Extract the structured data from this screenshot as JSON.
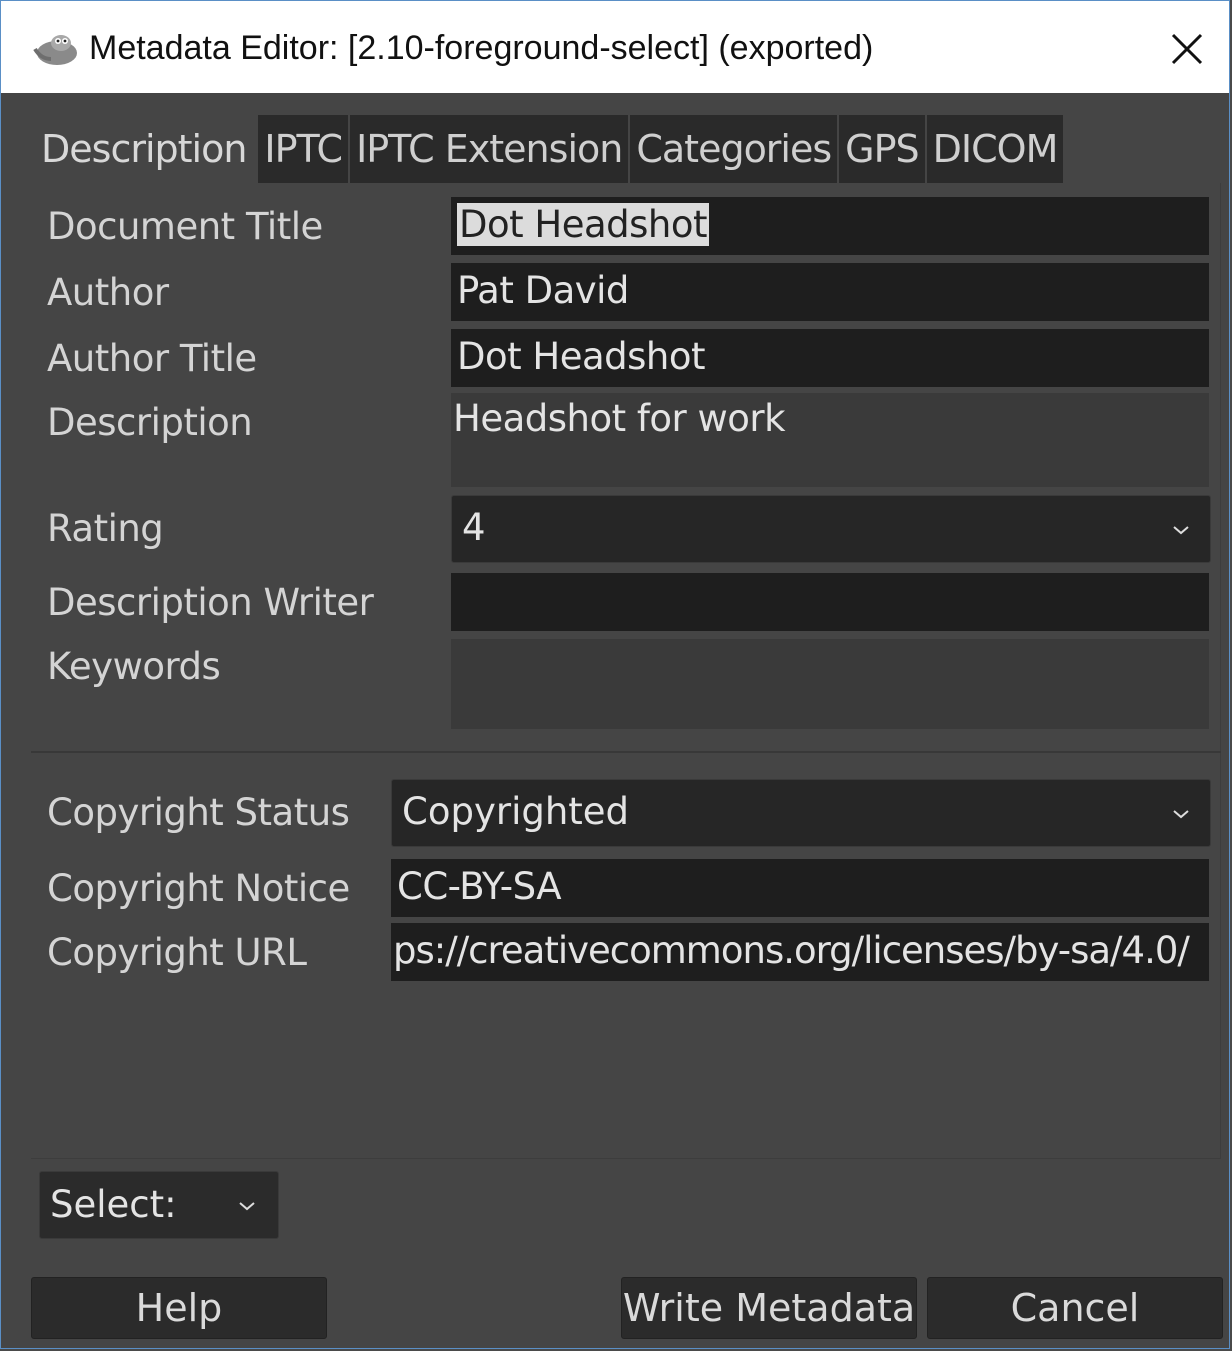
{
  "window": {
    "title": "Metadata Editor: [2.10-foreground-select] (exported)"
  },
  "tabs": [
    {
      "label": "Description",
      "active": true
    },
    {
      "label": "IPTC",
      "active": false
    },
    {
      "label": "IPTC Extension",
      "active": false
    },
    {
      "label": "Categories",
      "active": false
    },
    {
      "label": "GPS",
      "active": false
    },
    {
      "label": "DICOM",
      "active": false
    }
  ],
  "description": {
    "document_title_label": "Document Title",
    "document_title_value": "Dot Headshot",
    "author_label": "Author",
    "author_value": "Pat David",
    "author_title_label": "Author Title",
    "author_title_value": "Dot Headshot",
    "description_label": "Description",
    "description_value": "Headshot for work",
    "rating_label": "Rating",
    "rating_value": "4",
    "description_writer_label": "Description Writer",
    "description_writer_value": "",
    "keywords_label": "Keywords",
    "keywords_value": ""
  },
  "copyright": {
    "status_label": "Copyright Status",
    "status_value": "Copyrighted",
    "notice_label": "Copyright Notice",
    "notice_value": "CC-BY-SA",
    "url_label": "Copyright URL",
    "url_value": "ps://creativecommons.org/licenses/by-sa/4.0/"
  },
  "footer": {
    "select_label": "Select:",
    "help_label": "Help",
    "write_label": "Write Metadata",
    "cancel_label": "Cancel"
  },
  "colors": {
    "background": "#454545",
    "field": "#1e1e1e",
    "tab_inactive": "#2a2a2a",
    "titlebar": "#ffffff",
    "window_border": "#5a8fc6"
  }
}
